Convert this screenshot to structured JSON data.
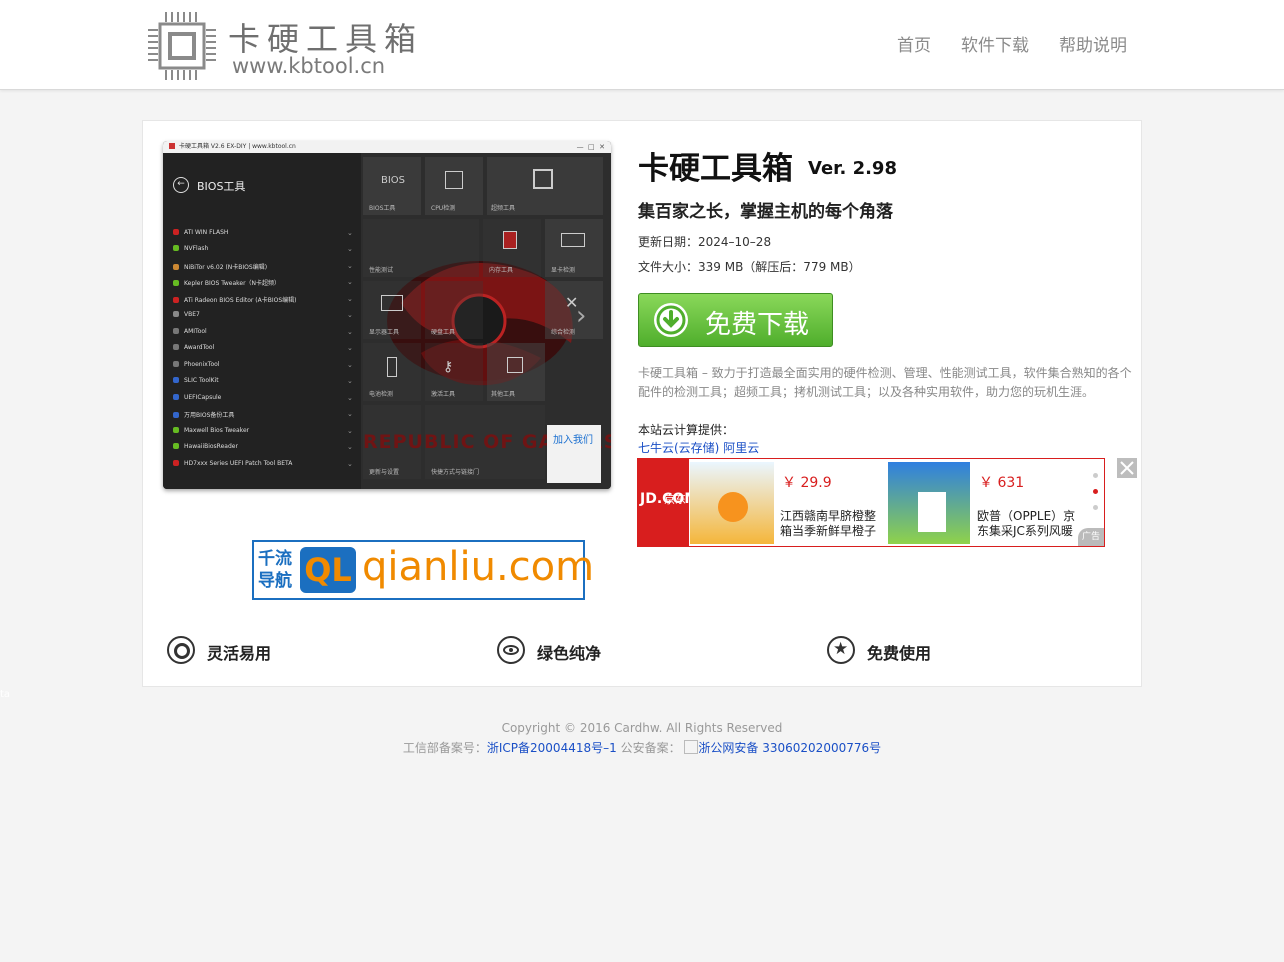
{
  "header": {
    "logo_title": "卡硬工具箱",
    "logo_url": "www.kbtool.cn",
    "nav": [
      "首页",
      "软件下载",
      "帮助说明"
    ]
  },
  "screenshot": {
    "window_title": "卡硬工具箱 V2.6  EX-DIY   |  www.kbtool.cn",
    "section_title": "BIOS工具",
    "menu": [
      "ATI WIN FLASH",
      "NVFlash",
      "NiBiTor v6.02 (N卡BIOS编辑)",
      "Kepler BIOS Tweaker（N卡超频）",
      "ATi Radeon BIOS Editor (A卡BIOS编辑)",
      "VBE7",
      "AMITool",
      "AwardTool",
      "PhoenixTool",
      "SLIC ToolKit",
      "UEFICapsule",
      "万用BIOS备份工具",
      "Maxwell Bios Tweaker",
      "HawaiiBiosReader",
      "HD7xxx Series UEFI Patch Tool BETA"
    ],
    "tiles": [
      "BIOS工具",
      "CPU检测",
      "超频工具",
      "性能测试",
      "内存工具",
      "显卡检测",
      "显示器工具",
      "硬盘工具",
      "综合检测",
      "电池检测",
      "激活工具",
      "其他工具",
      "更新与设置",
      "快捷方式与链接门"
    ],
    "tile_glyph_bios": "BIOS",
    "join_text": "加入我们",
    "watermark": "REPUBLIC OF GAMERS"
  },
  "product": {
    "name": "卡硬工具箱",
    "version": "Ver. 2.98",
    "slogan": "集百家之长，掌握主机的每个角落",
    "update_date": "更新日期：2024–10–28",
    "file_size": "文件大小：339 MB（解压后：779 MB）",
    "download_label": "免费下载",
    "description": "卡硬工具箱 – 致力于打造最全面实用的硬件检测、管理、性能测试工具，软件集合熟知的各个配件的检测工具；超频工具；拷机测试工具；以及各种实用软件，助力您的玩机生涯。",
    "cloud_label": "本站云计算提供：",
    "cloud_links": [
      "七牛云(云存储)",
      "阿里云"
    ]
  },
  "ad": {
    "brand": "JD.COM",
    "brand_cn": "京东",
    "items": [
      {
        "price": "￥ 29.9",
        "title": "江西赣南早脐橙整箱当季新鲜早橙子"
      },
      {
        "price": "￥ 631",
        "title": "欧普（OPPLE）京东集采JC系列风暖"
      }
    ],
    "tag": "广告"
  },
  "partner": {
    "cn_line1": "千流",
    "cn_line2": "导航",
    "badge": "QL",
    "domain": "qianliu.com"
  },
  "features": [
    "灵活易用",
    "绿色纯净",
    "免费使用"
  ],
  "footer": {
    "copyright": "Copyright © 2016 Cardhw. All Rights Reserved",
    "icp_label": "工信部备案号：",
    "icp_link": "浙ICP备20004418号–1",
    "police_label": "公安备案：",
    "police_link": "浙公网安备 33060202000776号"
  },
  "side_text": "ta",
  "colors": {
    "download_green": "#5cbf34",
    "jd_red": "#d81e1e",
    "link_blue": "#1a4fc6"
  }
}
